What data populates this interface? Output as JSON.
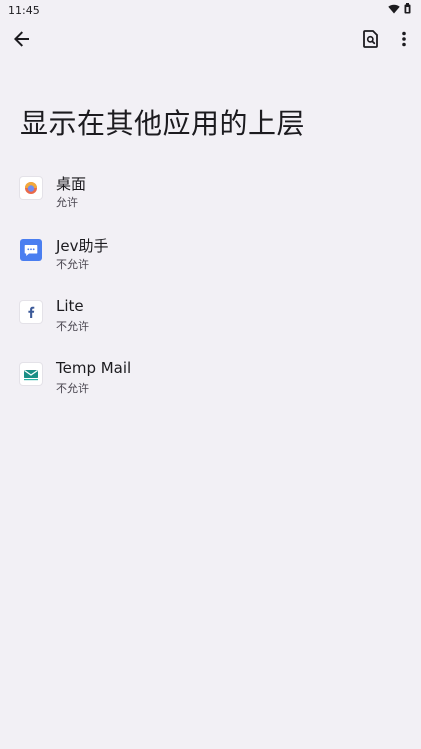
{
  "status_bar": {
    "time": "11:45"
  },
  "page": {
    "title": "显示在其他应用的上层"
  },
  "apps": [
    {
      "name": "桌面",
      "status": "允许",
      "icon": "launcher-icon"
    },
    {
      "name": "Jev助手",
      "status": "不允许",
      "icon": "chat-bubble-icon"
    },
    {
      "name": "Lite",
      "status": "不允许",
      "icon": "facebook-icon"
    },
    {
      "name": "Temp Mail",
      "status": "不允许",
      "icon": "mail-icon"
    }
  ],
  "colors": {
    "background": "#f2f0f5",
    "text_primary": "#1c1b1f",
    "text_secondary": "#49454f",
    "jev_blue": "#4a7ef0",
    "facebook_blue": "#3b5998",
    "mail_teal": "#1a8f86"
  }
}
